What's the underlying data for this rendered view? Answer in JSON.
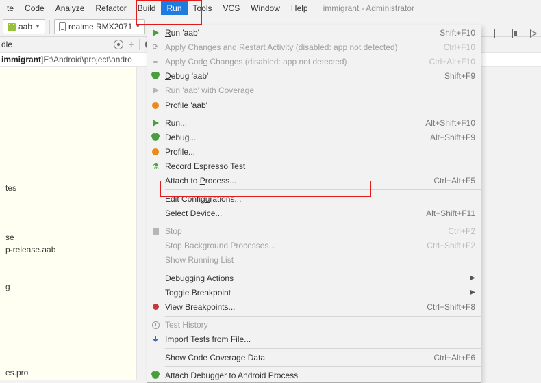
{
  "window": {
    "title": "immigrant - Administrator"
  },
  "menubar": [
    "te",
    "Code",
    "Analyze",
    "Refactor",
    "Build",
    "Run",
    "Tools",
    "VCS",
    "Window",
    "Help"
  ],
  "menubar_ul": [
    "",
    "C",
    "",
    "R",
    "B",
    "",
    "",
    "",
    "W",
    "H"
  ],
  "menubar_selected": 5,
  "toolbar": {
    "config": "aab",
    "device": "realme RMX2071"
  },
  "strip": {
    "label": "dle"
  },
  "breadcrumb": {
    "project": "immigrant",
    "path": "E:\\Android\\project\\andro"
  },
  "sidebar_lines": [
    "",
    "",
    "",
    "",
    "",
    "",
    "",
    "",
    "",
    "tes",
    "",
    "",
    "",
    "se",
    "p-release.aab",
    "",
    "",
    "g",
    "",
    "",
    "",
    "",
    "",
    "",
    "es.pro"
  ],
  "dropdown": [
    {
      "icon": "tri-green",
      "label_pre": "",
      "ul": "R",
      "label_post": "un 'aab'",
      "shortcut": "Shift+F10"
    },
    {
      "icon": "cycle-gray",
      "disabled": true,
      "label_pre": "Apply Changes and Restart Activit",
      "ul": "y",
      "label_post": " (disabled: app not detected)",
      "shortcut": "Ctrl+F10"
    },
    {
      "icon": "code-gray",
      "disabled": true,
      "label_pre": "Apply Cod",
      "ul": "e",
      "label_post": " Changes (disabled: app not detected)",
      "shortcut": "Ctrl+Alt+F10"
    },
    {
      "icon": "bug-green",
      "label_pre": "",
      "ul": "D",
      "label_post": "ebug 'aab'",
      "shortcut": "Shift+F9"
    },
    {
      "icon": "tri-gray",
      "disabled": true,
      "label_pre": "Run 'aab' with Coverage",
      "ul": "",
      "label_post": "",
      "shortcut": ""
    },
    {
      "icon": "circle-orange",
      "label_pre": "Profile 'aab'",
      "ul": "",
      "label_post": "",
      "shortcut": ""
    },
    {
      "sep": true
    },
    {
      "icon": "tri-green",
      "label_pre": "Ru",
      "ul": "n",
      "label_post": "...",
      "shortcut": "Alt+Shift+F10"
    },
    {
      "icon": "bug-green",
      "label_pre": "Debu",
      "ul": "g",
      "label_post": "...",
      "shortcut": "Alt+Shift+F9"
    },
    {
      "icon": "circle-orange",
      "label_pre": "Profile...",
      "ul": "",
      "label_post": "",
      "shortcut": ""
    },
    {
      "icon": "flask",
      "label_pre": "Record Espresso Test",
      "ul": "",
      "label_post": "",
      "shortcut": ""
    },
    {
      "icon": "",
      "label_pre": "Attach to ",
      "ul": "P",
      "label_post": "rocess...",
      "shortcut": "Ctrl+Alt+F5"
    },
    {
      "sep": true
    },
    {
      "icon": "",
      "label_pre": "Edit Config",
      "ul": "u",
      "label_post": "rations...",
      "shortcut": ""
    },
    {
      "icon": "",
      "label_pre": "Select Dev",
      "ul": "i",
      "label_post": "ce...",
      "shortcut": "Alt+Shift+F11"
    },
    {
      "sep": true
    },
    {
      "icon": "stop-sq",
      "disabled": true,
      "label_pre": "Stop",
      "ul": "",
      "label_post": "",
      "shortcut": "Ctrl+F2"
    },
    {
      "icon": "",
      "disabled": true,
      "label_pre": "Stop Background Processes...",
      "ul": "",
      "label_post": "",
      "shortcut": "Ctrl+Shift+F2"
    },
    {
      "icon": "",
      "disabled": true,
      "label_pre": "Show Running List",
      "ul": "",
      "label_post": "",
      "shortcut": ""
    },
    {
      "sep": true
    },
    {
      "icon": "",
      "label_pre": "Debugging Actions",
      "ul": "",
      "label_post": "",
      "submenu": true
    },
    {
      "icon": "",
      "label_pre": "Toggle Breakpoint",
      "ul": "",
      "label_post": "",
      "submenu": true
    },
    {
      "icon": "circle-red",
      "label_pre": "View Brea",
      "ul": "k",
      "label_post": "points...",
      "shortcut": "Ctrl+Shift+F8"
    },
    {
      "sep": true
    },
    {
      "icon": "clock",
      "disabled": true,
      "label_pre": "Test History",
      "ul": "",
      "label_post": "",
      "shortcut": ""
    },
    {
      "icon": "import-ic",
      "label_pre": "Im",
      "ul": "p",
      "label_post": "ort Tests from File...",
      "shortcut": ""
    },
    {
      "sep": true
    },
    {
      "icon": "",
      "label_pre": "Show Code Coverage Data",
      "ul": "",
      "label_post": "",
      "shortcut": "Ctrl+Alt+F6"
    },
    {
      "sep": true
    },
    {
      "icon": "bug-attach",
      "label_pre": "Attach Debugger to Android Process",
      "ul": "",
      "label_post": "",
      "shortcut": ""
    }
  ]
}
